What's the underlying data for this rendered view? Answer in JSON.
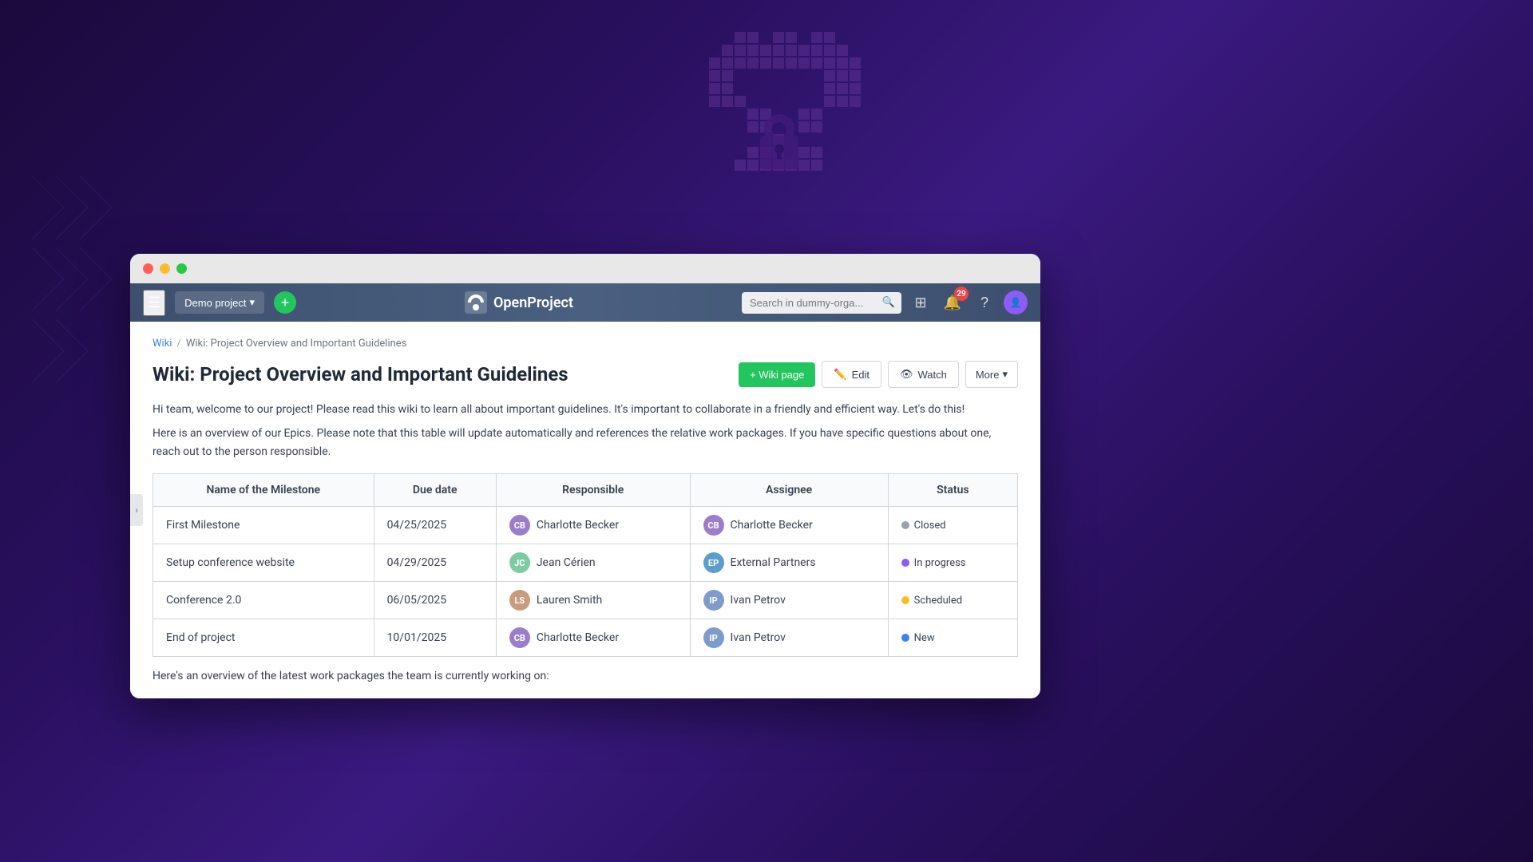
{
  "background": {
    "color1": "#1a0a3c",
    "color2": "#2a1060"
  },
  "nav": {
    "project_label": "Demo project",
    "logo_text": "OpenProject",
    "search_placeholder": "Search in dummy-orga...",
    "notification_count": "29"
  },
  "breadcrumb": {
    "wiki_label": "Wiki",
    "separator": "/",
    "current": "Wiki: Project Overview and Important Guidelines"
  },
  "page": {
    "title": "Wiki: Project Overview and Important Guidelines",
    "description1": "Hi team, welcome to our project! Please read this wiki to learn all about important guidelines. It's important to collaborate in a friendly and efficient way. Let's do this!",
    "description2": "Here is an overview of our Epics. Please note that this table will update automatically and references the relative work packages. If you have specific questions about one, reach out to the person responsible.",
    "bottom_text": "Here's an overview of the latest work packages the team is currently working on:"
  },
  "actions": {
    "wiki_page_label": "+ Wiki page",
    "edit_label": "Edit",
    "watch_label": "Watch",
    "more_label": "More"
  },
  "table": {
    "headers": [
      "Name of the Milestone",
      "Due date",
      "Responsible",
      "Assignee",
      "Status"
    ],
    "rows": [
      {
        "name": "First Milestone",
        "due_date": "04/25/2025",
        "responsible": "Charlotte Becker",
        "responsible_initials": "CB",
        "assignee": "Charlotte Becker",
        "assignee_initials": "CB",
        "status": "Closed",
        "status_type": "closed"
      },
      {
        "name": "Setup conference website",
        "due_date": "04/29/2025",
        "responsible": "Jean Cérien",
        "responsible_initials": "JC",
        "assignee": "External Partners",
        "assignee_initials": "EP",
        "status": "In progress",
        "status_type": "in-progress"
      },
      {
        "name": "Conference 2.0",
        "due_date": "06/05/2025",
        "responsible": "Lauren Smith",
        "responsible_initials": "LS",
        "assignee": "Ivan Petrov",
        "assignee_initials": "IP",
        "status": "Scheduled",
        "status_type": "scheduled"
      },
      {
        "name": "End of project",
        "due_date": "10/01/2025",
        "responsible": "Charlotte Becker",
        "responsible_initials": "CB",
        "assignee": "Ivan Petrov",
        "assignee_initials": "IP",
        "status": "New",
        "status_type": "new"
      }
    ]
  }
}
